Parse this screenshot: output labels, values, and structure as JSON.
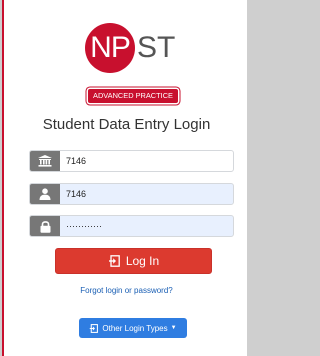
{
  "logo": {
    "circle_text": "NP",
    "rest_text": "ST",
    "brand_color": "#c8102e"
  },
  "badge": {
    "label": "ADVANCED PRACTICE"
  },
  "heading": "Student Data Entry Login",
  "fields": {
    "school": {
      "value": "7146",
      "icon": "bank-icon"
    },
    "user": {
      "value": "7146",
      "icon": "user-icon"
    },
    "password": {
      "value": "············",
      "icon": "lock-icon"
    }
  },
  "login_button": {
    "label": "Log In",
    "icon": "sign-in-icon",
    "color": "#dc3a2f"
  },
  "forgot_link": "Forgot login or password?",
  "other_login": {
    "label": "Other Login Types",
    "caret": "▼",
    "color": "#2f7de1"
  }
}
